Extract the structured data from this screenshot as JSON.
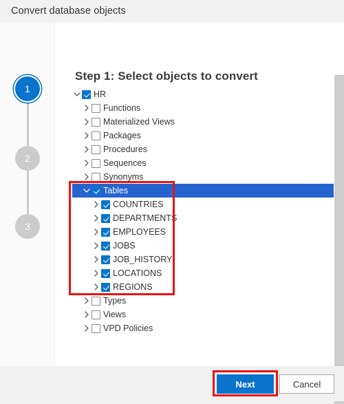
{
  "window": {
    "title": "Convert database objects"
  },
  "stepper": {
    "steps": [
      {
        "number": "1",
        "state": "current"
      },
      {
        "number": "2",
        "state": "pending"
      },
      {
        "number": "3",
        "state": "pending"
      }
    ]
  },
  "main": {
    "heading": "Step 1: Select objects to convert"
  },
  "tree": {
    "rows": [
      {
        "label": "HR",
        "depth": 0,
        "chevron": "down",
        "checked": true,
        "selected": false
      },
      {
        "label": "Functions",
        "depth": 1,
        "chevron": "right",
        "checked": false,
        "selected": false
      },
      {
        "label": "Materialized Views",
        "depth": 1,
        "chevron": "right",
        "checked": false,
        "selected": false
      },
      {
        "label": "Packages",
        "depth": 1,
        "chevron": "right",
        "checked": false,
        "selected": false
      },
      {
        "label": "Procedures",
        "depth": 1,
        "chevron": "right",
        "checked": false,
        "selected": false
      },
      {
        "label": "Sequences",
        "depth": 1,
        "chevron": "right",
        "checked": false,
        "selected": false
      },
      {
        "label": "Synonyms",
        "depth": 1,
        "chevron": "right",
        "checked": false,
        "selected": false
      },
      {
        "label": "Tables",
        "depth": 1,
        "chevron": "down",
        "checked": true,
        "selected": true
      },
      {
        "label": "COUNTRIES",
        "depth": 2,
        "chevron": "right",
        "checked": true,
        "selected": false
      },
      {
        "label": "DEPARTMENTS",
        "depth": 2,
        "chevron": "right",
        "checked": true,
        "selected": false
      },
      {
        "label": "EMPLOYEES",
        "depth": 2,
        "chevron": "right",
        "checked": true,
        "selected": false
      },
      {
        "label": "JOBS",
        "depth": 2,
        "chevron": "right",
        "checked": true,
        "selected": false
      },
      {
        "label": "JOB_HISTORY",
        "depth": 2,
        "chevron": "right",
        "checked": true,
        "selected": false
      },
      {
        "label": "LOCATIONS",
        "depth": 2,
        "chevron": "right",
        "checked": true,
        "selected": false
      },
      {
        "label": "REGIONS",
        "depth": 2,
        "chevron": "right",
        "checked": true,
        "selected": false
      },
      {
        "label": "Types",
        "depth": 1,
        "chevron": "right",
        "checked": false,
        "selected": false
      },
      {
        "label": "Views",
        "depth": 1,
        "chevron": "right",
        "checked": false,
        "selected": false
      },
      {
        "label": "VPD Policies",
        "depth": 1,
        "chevron": "right",
        "checked": false,
        "selected": false
      }
    ]
  },
  "footer": {
    "next_label": "Next",
    "cancel_label": "Cancel"
  },
  "colors": {
    "accent": "#0a74cd",
    "selection": "#2564cf",
    "annotation": "#ee1111",
    "step_pending": "#cccccc"
  }
}
